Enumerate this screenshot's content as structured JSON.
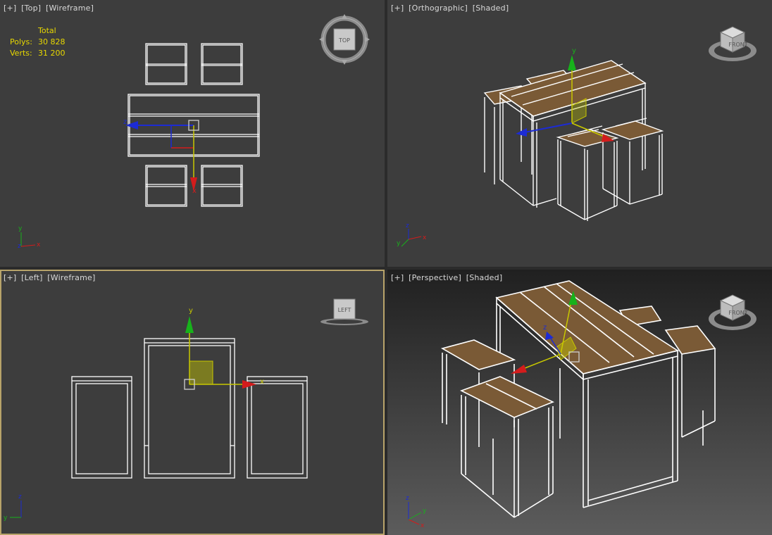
{
  "viewports": {
    "top": {
      "labels": [
        "[+]",
        "[Top]",
        "[Wireframe]"
      ],
      "cube_face": "TOP"
    },
    "ortho": {
      "labels": [
        "[+]",
        "[Orthographic]",
        "[Shaded]"
      ],
      "cube_face": "FRONT"
    },
    "left": {
      "labels": [
        "[+]",
        "[Left]",
        "[Wireframe]"
      ],
      "cube_face": "LEFT"
    },
    "persp": {
      "labels": [
        "[+]",
        "[Perspective]",
        "[Shaded]"
      ],
      "cube_face": "FRONT"
    }
  },
  "stats": {
    "header": "Total",
    "polys_label": "Polys:",
    "polys_value": "30 828",
    "verts_label": "Verts:",
    "verts_value": "31 200"
  },
  "axis_letters": {
    "x": "x",
    "y": "y",
    "z": "z"
  },
  "colors": {
    "viewport_bg": "#3d3d3d",
    "gap": "#2b2b2b",
    "active_border": "#b8a46a",
    "wire": "#ffffff",
    "wood": "#7a5a36",
    "gizmo_x": "#d41c1c",
    "gizmo_y": "#17b21b",
    "gizmo_z": "#1c2bd4",
    "gizmo_plane": "#c8c800",
    "stats_text": "#e8d800"
  }
}
